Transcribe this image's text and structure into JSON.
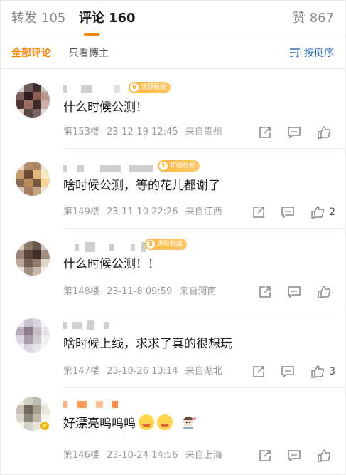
{
  "tabs": {
    "repost": {
      "label": "转发",
      "count": "105"
    },
    "comment": {
      "label": "评论",
      "count": "160"
    },
    "like": {
      "label": "赞",
      "count": "867"
    }
  },
  "filters": {
    "all": "全部评论",
    "owner_only": "只看博主",
    "sort": "按倒序"
  },
  "colors": {
    "accent": "#ff8200",
    "link": "#2e6dba",
    "fan_badge": "#ffb740"
  },
  "comments": [
    {
      "badge": {
        "level": "6",
        "label": "活跃粉丝"
      },
      "text": "什么时候公测！",
      "floor": "第153楼",
      "time": "23-12-19 12:45",
      "location": "来自贵州",
      "likes": ""
    },
    {
      "badge": {
        "level": "1",
        "label": "初级粉丝"
      },
      "text": "啥时候公测，等的花儿都谢了",
      "floor": "第149楼",
      "time": "23-11-10 22:26",
      "location": "来自江西",
      "likes": "2"
    },
    {
      "badge": {
        "level": "5",
        "label": "进阶粉丝"
      },
      "text": "什么时候公测！！",
      "floor": "第148楼",
      "time": "23-11-8 09:59",
      "location": "来自河南",
      "likes": ""
    },
    {
      "badge": null,
      "text": "啥时候上线，求求了真的很想玩",
      "floor": "第147楼",
      "time": "23-10-26 13:14",
      "location": "来自湖北",
      "likes": "3"
    },
    {
      "badge": null,
      "text": "好漂亮呜呜呜",
      "emoji": [
        "smiling-face-with-hearts",
        "smiling-face-with-hearts"
      ],
      "floor": "第146楼",
      "time": "23-10-24 14:56",
      "location": "来自上海",
      "likes": ""
    }
  ]
}
